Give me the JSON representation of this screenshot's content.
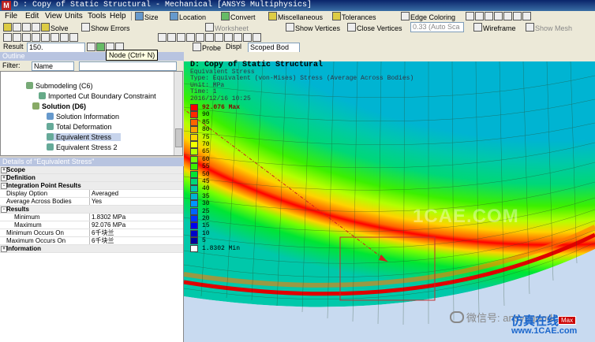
{
  "window": {
    "app_letter": "M",
    "title": "D : Copy of Static Structural - Mechanical [ANSYS Multiphysics]"
  },
  "menu": [
    "File",
    "Edit",
    "View",
    "Units",
    "Tools",
    "Help"
  ],
  "toolbar_row1": {
    "size": "Size",
    "location": "Location",
    "convert": "Convert",
    "miscellaneous": "Miscellaneous",
    "tolerances": "Tolerances",
    "edge_coloring": "Edge Coloring"
  },
  "toolbar_row2": {
    "solve": "Solve",
    "show_errors": "Show Errors",
    "worksheet": "Worksheet",
    "show_vertices": "Show Vertices",
    "close_vertices": "Close Vertices",
    "auto_scale_value": "0.33 (Auto Sca",
    "wireframe": "Wireframe",
    "show_mesh": "Show Mesh"
  },
  "result_bar": {
    "label": "Result",
    "value": "150.",
    "probe": "Probe",
    "display_label": "Displ",
    "scoped": "Scoped Bod",
    "tooltip": "Node (Ctrl+ N)"
  },
  "outline": {
    "header": "Outline",
    "filter_label": "Filter:",
    "filter_value": "Name",
    "items": [
      {
        "label": "Submodeling (C6)",
        "bold": false
      },
      {
        "label": "Imported Cut Boundary Constraint",
        "bold": false
      },
      {
        "label": "Solution (D6)",
        "bold": true
      },
      {
        "label": "Solution Information",
        "bold": false
      },
      {
        "label": "Total Deformation",
        "bold": false
      },
      {
        "label": "Equivalent Stress",
        "bold": false,
        "selected": true
      },
      {
        "label": "Equivalent Stress 2",
        "bold": false
      }
    ]
  },
  "details": {
    "header": "Details of \"Equivalent Stress\"",
    "rows": [
      {
        "key": "Scope",
        "value": "",
        "section": true
      },
      {
        "key": "Definition",
        "value": "",
        "section": true
      },
      {
        "key": "Integration Point Results",
        "value": "",
        "section": true
      },
      {
        "key": "Display Option",
        "value": "Averaged"
      },
      {
        "key": "Average Across Bodies",
        "value": "Yes"
      },
      {
        "key": "Results",
        "value": "",
        "section": true
      },
      {
        "key": "Minimum",
        "value": "1.8302 MPa",
        "indent": true
      },
      {
        "key": "Maximum",
        "value": "92.076 MPa",
        "indent": true
      },
      {
        "key": "Minimum Occurs On",
        "value": "6千块兰"
      },
      {
        "key": "Maximum Occurs On",
        "value": "6千块兰"
      },
      {
        "key": "Information",
        "value": "",
        "section": true
      }
    ]
  },
  "viewport": {
    "title": "D: Copy of Static Structural",
    "lines": [
      "Equivalent Stress",
      "Type: Equivalent (von-Mises) Stress (Average Across Bodies)",
      "Unit: MPa",
      "Time: 1",
      "2016/12/16 10:25"
    ],
    "legend": [
      {
        "label": "92.076 Max",
        "color": "#ff0000"
      },
      {
        "label": "90",
        "color": "#ff2800"
      },
      {
        "label": "85",
        "color": "#ff6400"
      },
      {
        "label": "80",
        "color": "#ffa000"
      },
      {
        "label": "75",
        "color": "#ffd200"
      },
      {
        "label": "70",
        "color": "#f0ff00"
      },
      {
        "label": "65",
        "color": "#b4ff00"
      },
      {
        "label": "60",
        "color": "#78ff00"
      },
      {
        "label": "55",
        "color": "#3cf000"
      },
      {
        "label": "50",
        "color": "#00e632"
      },
      {
        "label": "45",
        "color": "#00d778"
      },
      {
        "label": "40",
        "color": "#00c8aa"
      },
      {
        "label": "35",
        "color": "#00b4d2"
      },
      {
        "label": "30",
        "color": "#0096ff"
      },
      {
        "label": "25",
        "color": "#0064ff"
      },
      {
        "label": "20",
        "color": "#0032ff"
      },
      {
        "label": "15",
        "color": "#0000f0"
      },
      {
        "label": "10",
        "color": "#0000c8"
      },
      {
        "label": "5",
        "color": "#0000a0"
      },
      {
        "label": "1.8302 Min",
        "color": "#ffffff"
      }
    ],
    "max_tag": "Max",
    "watermark": "1CAE.COM"
  },
  "footer": {
    "wechat": "微信号: ansysgoodc",
    "site_name": "仿真在线",
    "site_url": "www.1CAE.com"
  }
}
